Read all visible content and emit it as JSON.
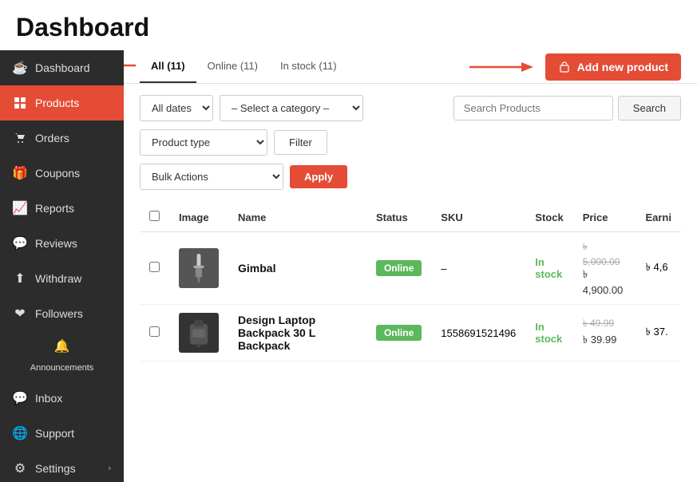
{
  "page": {
    "title": "Dashboard"
  },
  "sidebar": {
    "items": [
      {
        "id": "dashboard",
        "label": "Dashboard",
        "icon": "🏠",
        "active": false
      },
      {
        "id": "products",
        "label": "Products",
        "icon": "🛍",
        "active": true
      },
      {
        "id": "orders",
        "label": "Orders",
        "icon": "🛒",
        "active": false
      },
      {
        "id": "coupons",
        "label": "Coupons",
        "icon": "🎁",
        "active": false
      },
      {
        "id": "reports",
        "label": "Reports",
        "icon": "📈",
        "active": false
      },
      {
        "id": "reviews",
        "label": "Reviews",
        "icon": "💬",
        "active": false
      },
      {
        "id": "withdraw",
        "label": "Withdraw",
        "icon": "⬆",
        "active": false
      },
      {
        "id": "followers",
        "label": "Followers",
        "icon": "❤",
        "active": false
      },
      {
        "id": "announcements",
        "label": "Announcements",
        "icon": "🔔",
        "active": false
      },
      {
        "id": "inbox",
        "label": "Inbox",
        "icon": "💬",
        "active": false
      },
      {
        "id": "support",
        "label": "Support",
        "icon": "🌐",
        "active": false
      },
      {
        "id": "settings",
        "label": "Settings",
        "icon": "⚙",
        "active": false,
        "hasArrow": true
      }
    ]
  },
  "tabs": [
    {
      "id": "all",
      "label": "All (11)",
      "active": true
    },
    {
      "id": "online",
      "label": "Online (11)",
      "active": false
    },
    {
      "id": "instock",
      "label": "In stock (11)",
      "active": false
    }
  ],
  "toolbar": {
    "add_product_label": "Add new product"
  },
  "filters": {
    "date_options": [
      "All dates"
    ],
    "date_selected": "All dates",
    "category_placeholder": "– Select a category –",
    "search_btn_label": "Search",
    "product_type_selected": "Product type",
    "filter_btn_label": "Filter",
    "bulk_actions_selected": "Bulk Actions",
    "apply_btn_label": "Apply",
    "search_input_placeholder": "Search Products"
  },
  "table": {
    "headers": [
      "",
      "Image",
      "Name",
      "Status",
      "SKU",
      "Stock",
      "Price",
      "Earni"
    ],
    "rows": [
      {
        "name": "Gimbal",
        "status": "Online",
        "sku": "–",
        "stock": "In stock",
        "price_original": "৳ 5,000.00",
        "price_sale": "৳ 4,900.00",
        "earnings": "৳ 4,6",
        "img_type": "gimbal"
      },
      {
        "name": "Design Laptop Backpack 30 L Backpack",
        "status": "Online",
        "sku": "1558691521496",
        "stock": "In stock",
        "price_original": "৳ 49.99",
        "price_sale": "৳ 39.99",
        "earnings": "৳ 37.",
        "img_type": "backpack"
      }
    ]
  },
  "colors": {
    "accent_red": "#e44c36",
    "sidebar_bg": "#2c2c2c",
    "online_green": "#5cb85c"
  }
}
